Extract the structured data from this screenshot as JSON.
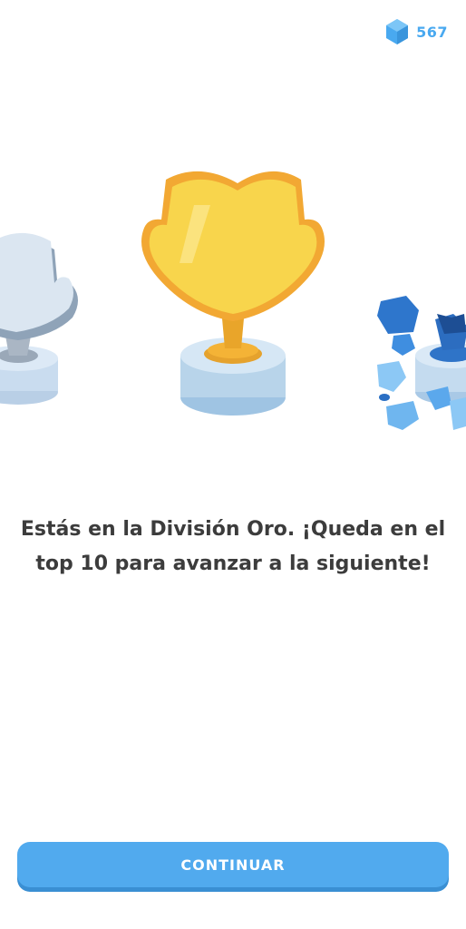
{
  "header": {
    "gems_count": "567",
    "gem_icon": "gem-icon"
  },
  "trophies": {
    "left": "silver-trophy-icon",
    "center": "gold-trophy-icon",
    "right": "sapphire-trophy-icon"
  },
  "message": {
    "text": "Estás en la División Oro. ¡Queda en el top 10 para avanzar a la siguiente!"
  },
  "footer": {
    "continue_label": "CONTINUAR"
  },
  "colors": {
    "accent": "#51aaee",
    "gem": "#49a9f0",
    "gold": "#f7d14a",
    "text": "#3c3c3c"
  }
}
